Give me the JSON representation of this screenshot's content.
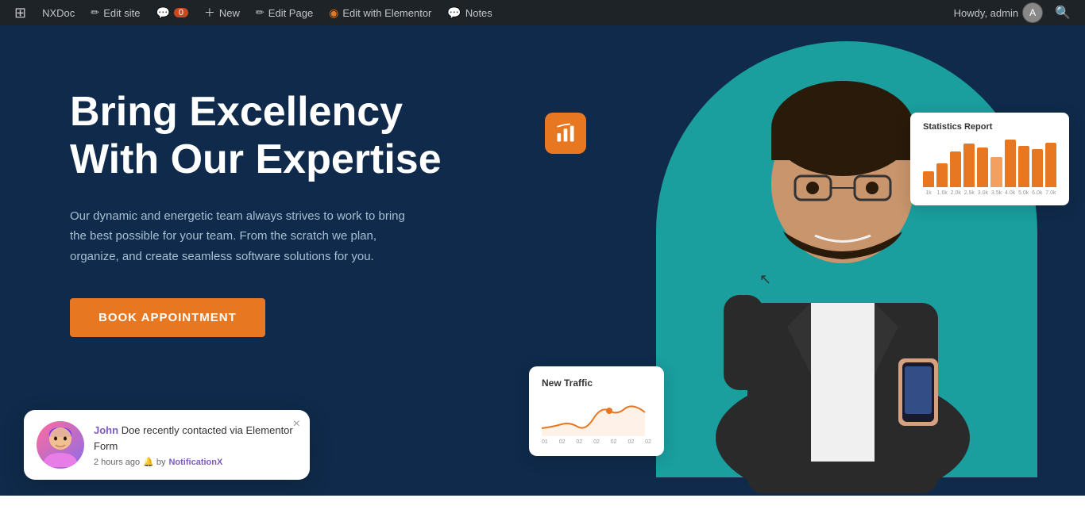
{
  "adminbar": {
    "wp_label": "W",
    "site_name": "NXDoc",
    "edit_site": "Edit site",
    "comments_label": "0",
    "new_label": "New",
    "edit_page_label": "Edit Page",
    "elementor_label": "Edit with Elementor",
    "notes_label": "Notes",
    "howdy": "Howdy, admin"
  },
  "hero": {
    "title": "Bring Excellency With Our Expertise",
    "description": "Our dynamic and energetic team always strives to work to bring the best possible for your team. From the scratch we plan, organize, and create seamless software solutions for you.",
    "cta_button": "BOOK APPOINTMENT"
  },
  "stats_card": {
    "title": "Statistics Report",
    "bars": [
      {
        "height": 20,
        "color": "#e87722",
        "label": "1k"
      },
      {
        "height": 30,
        "color": "#e87722",
        "label": "1.6k"
      },
      {
        "height": 45,
        "color": "#e87722",
        "label": "2.0k"
      },
      {
        "height": 55,
        "color": "#e87722",
        "label": "2.5k"
      },
      {
        "height": 50,
        "color": "#e87722",
        "label": "3.0k"
      },
      {
        "height": 38,
        "color": "#f0a060",
        "label": "3.5k"
      },
      {
        "height": 60,
        "color": "#e87722",
        "label": "4.0k"
      },
      {
        "height": 52,
        "color": "#e87722",
        "label": "5.0k"
      },
      {
        "height": 48,
        "color": "#e87722",
        "label": "6.0k"
      },
      {
        "height": 56,
        "color": "#e87722",
        "label": "7.0k"
      }
    ]
  },
  "traffic_card": {
    "title": "New Traffic",
    "labels": [
      "01",
      "02",
      "02",
      "02",
      "02",
      "02",
      "02"
    ]
  },
  "notification": {
    "name": "John",
    "rest_text": "Doe recently contacted via Elementor Form",
    "time_text": "2 hours ago",
    "by_text": "by",
    "plugin_name": "NotificationX",
    "close_label": "×"
  },
  "cursor_visible": true
}
